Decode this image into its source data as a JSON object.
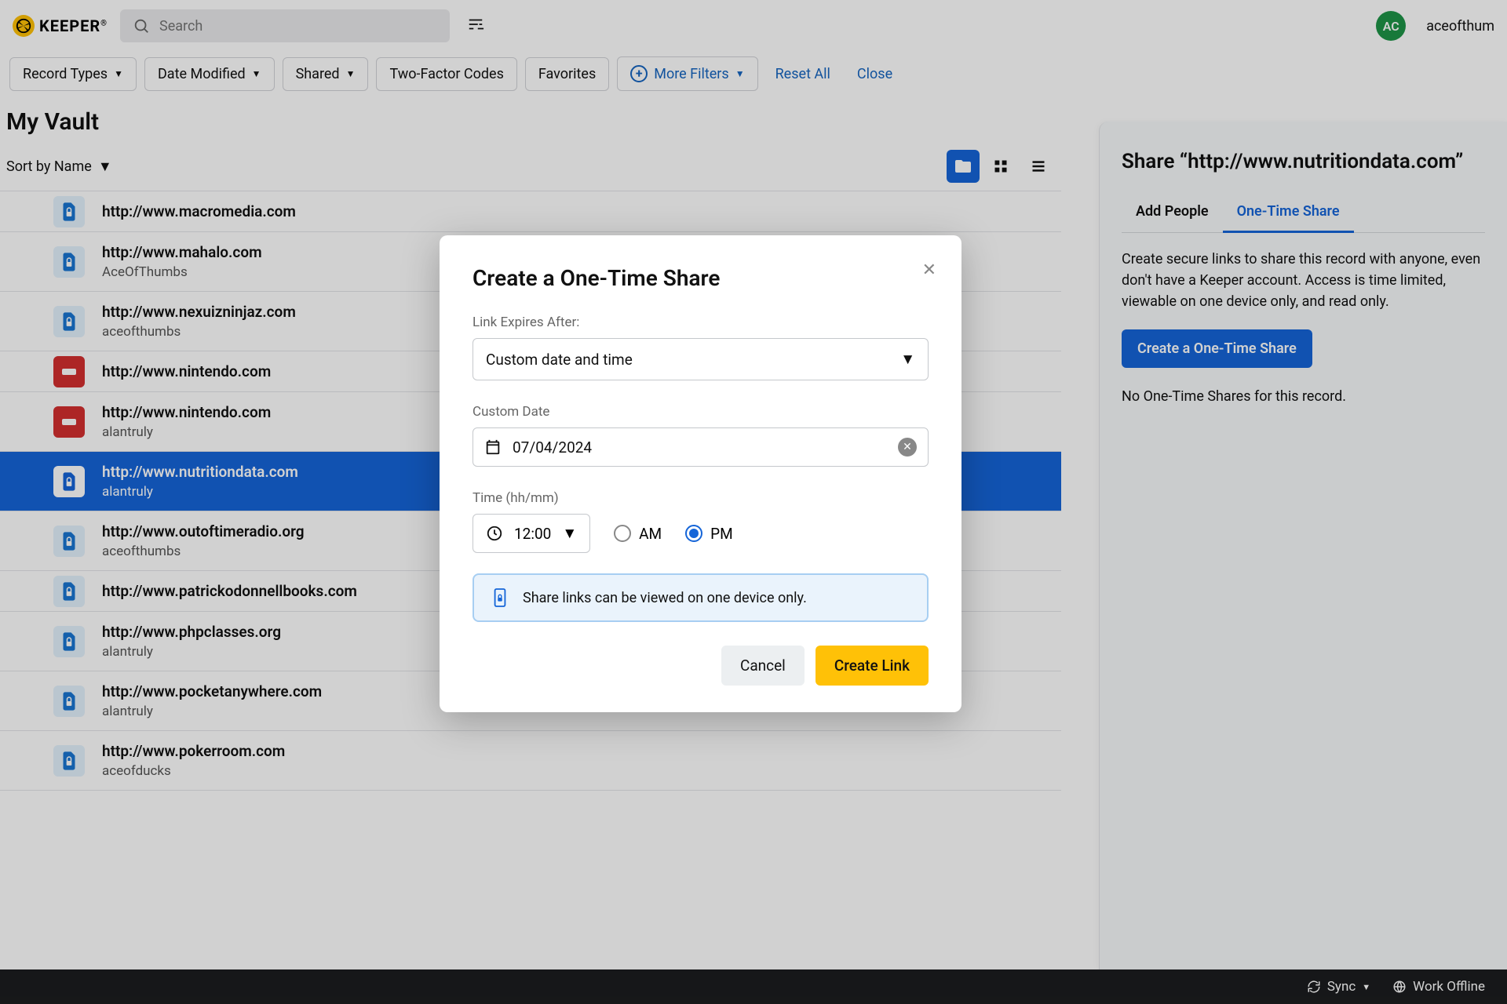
{
  "brand": {
    "name": "KEEPER"
  },
  "search": {
    "placeholder": "Search"
  },
  "user": {
    "initials": "AC",
    "name": "aceofthum"
  },
  "filters": {
    "record_types": "Record Types",
    "date_modified": "Date Modified",
    "shared": "Shared",
    "two_factor": "Two-Factor Codes",
    "favorites": "Favorites",
    "more": "More Filters",
    "reset": "Reset All",
    "close": "Close"
  },
  "page": {
    "title": "My Vault",
    "sort": "Sort by Name"
  },
  "records": [
    {
      "title": "http://www.macromedia.com",
      "sub": "",
      "icon": "blue"
    },
    {
      "title": "http://www.mahalo.com",
      "sub": "AceOfThumbs",
      "icon": "blue"
    },
    {
      "title": "http://www.nexuizninjaz.com",
      "sub": "aceofthumbs",
      "icon": "blue"
    },
    {
      "title": "http://www.nintendo.com",
      "sub": "",
      "icon": "red"
    },
    {
      "title": "http://www.nintendo.com",
      "sub": "alantruly",
      "icon": "red"
    },
    {
      "title": "http://www.nutritiondata.com",
      "sub": "alantruly",
      "icon": "blue",
      "selected": true
    },
    {
      "title": "http://www.outoftimeradio.org",
      "sub": "aceofthumbs",
      "icon": "blue"
    },
    {
      "title": "http://www.patrickodonnellbooks.com",
      "sub": "",
      "icon": "blue"
    },
    {
      "title": "http://www.phpclasses.org",
      "sub": "alantruly",
      "icon": "blue"
    },
    {
      "title": "http://www.pocketanywhere.com",
      "sub": "alantruly",
      "icon": "blue"
    },
    {
      "title": "http://www.pokerroom.com",
      "sub": "aceofducks",
      "icon": "blue"
    }
  ],
  "panel": {
    "title": "Share “http://www.nutritiondata.com”",
    "tab_add": "Add People",
    "tab_ots": "One-Time Share",
    "desc": "Create secure links to share this record with anyone, even don't have a Keeper account. Access is time limited, viewable on one device only, and read only.",
    "cta": "Create a One-Time Share",
    "empty": "No One-Time Shares for this record."
  },
  "modal": {
    "title": "Create a One-Time Share",
    "expires_label": "Link Expires After:",
    "expires_value": "Custom date and time",
    "date_label": "Custom Date",
    "date_value": "07/04/2024",
    "time_label": "Time (hh/mm)",
    "time_value": "12:00",
    "am": "AM",
    "pm": "PM",
    "info": "Share links can be viewed on one device only.",
    "cancel": "Cancel",
    "create": "Create Link"
  },
  "footer": {
    "sync": "Sync",
    "offline": "Work Offline"
  }
}
